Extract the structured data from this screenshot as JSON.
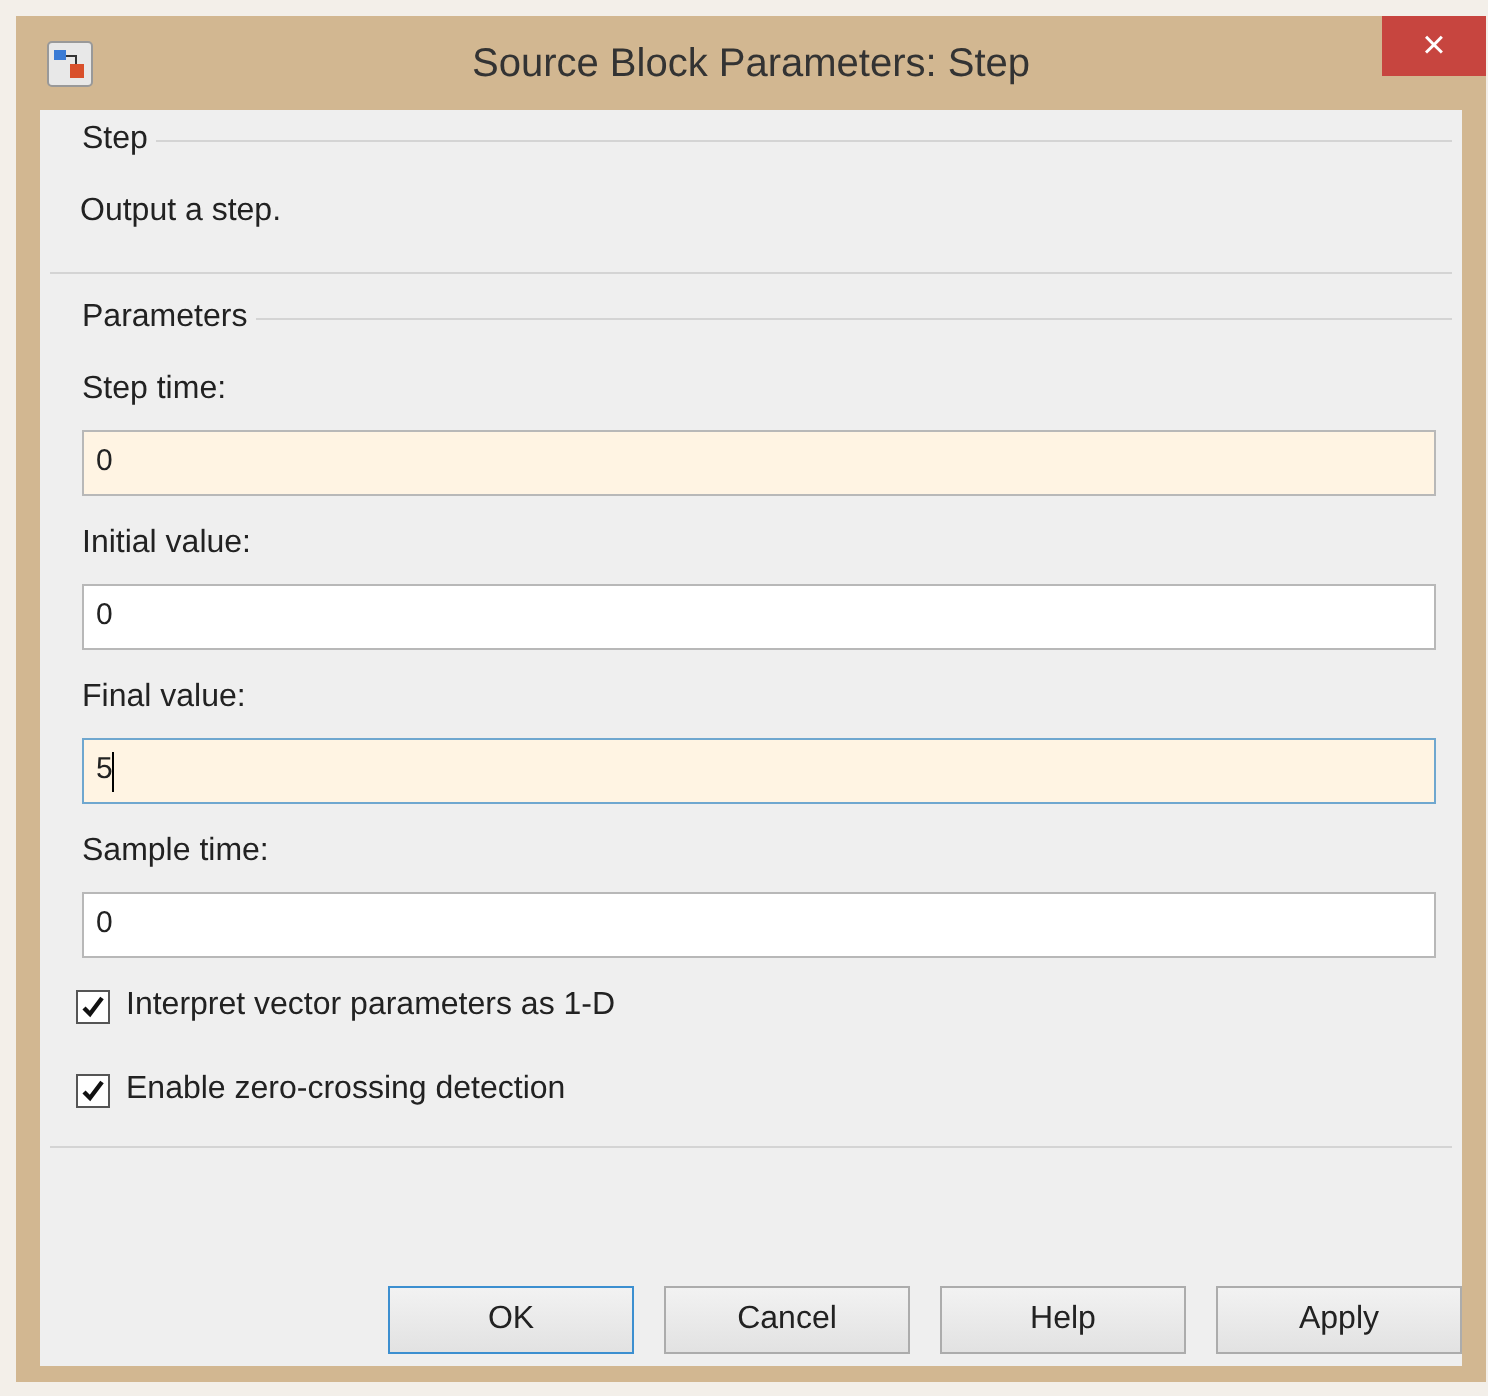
{
  "window": {
    "title": "Source Block Parameters: Step",
    "close_label": "×"
  },
  "description_group": {
    "title": "Step",
    "text": "Output a step."
  },
  "parameters_group": {
    "title": "Parameters",
    "fields": [
      {
        "label": "Step time:",
        "value": "0",
        "highlighted": true,
        "focused": false
      },
      {
        "label": "Initial value:",
        "value": "0",
        "highlighted": false,
        "focused": false
      },
      {
        "label": "Final value:",
        "value": "5",
        "highlighted": true,
        "focused": true
      },
      {
        "label": "Sample time:",
        "value": "0",
        "highlighted": false,
        "focused": false
      }
    ],
    "checkboxes": [
      {
        "label": "Interpret vector parameters as 1-D",
        "checked": true
      },
      {
        "label": "Enable zero-crossing detection",
        "checked": true
      }
    ]
  },
  "buttons": [
    {
      "label": "OK",
      "default": true
    },
    {
      "label": "Cancel",
      "default": false
    },
    {
      "label": "Help",
      "default": false
    },
    {
      "label": "Apply",
      "default": false
    }
  ]
}
